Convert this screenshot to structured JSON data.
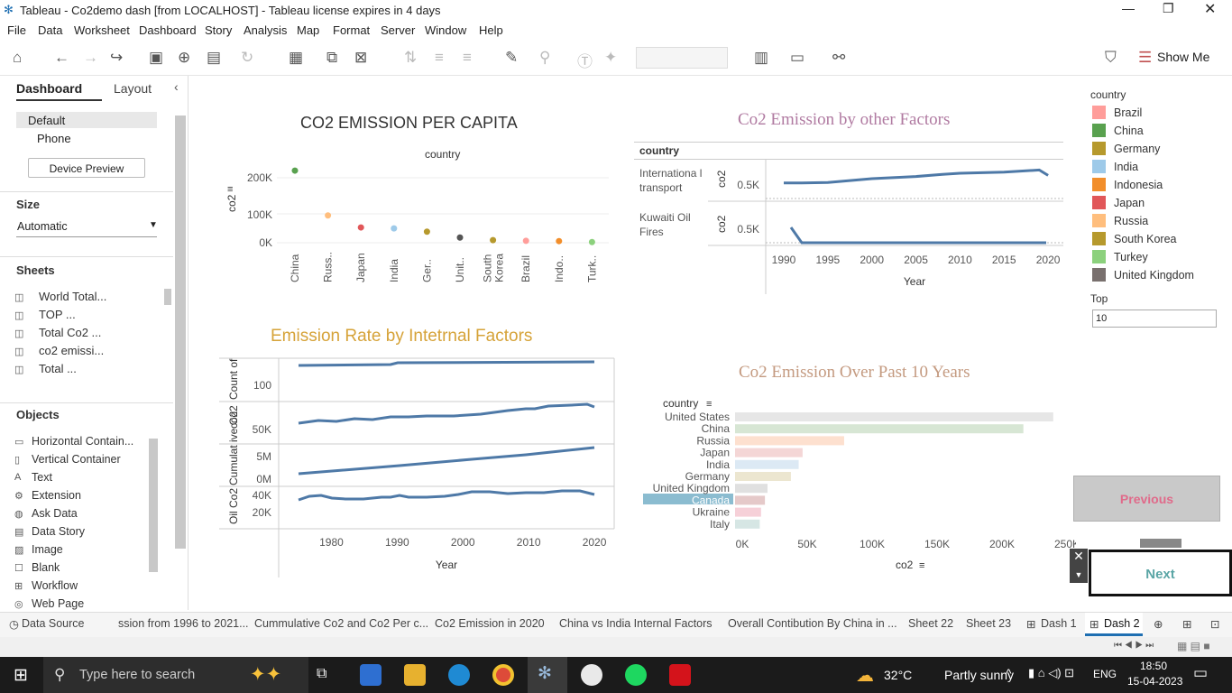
{
  "window": {
    "title": "Tableau - Co2demo dash [from LOCALHOST] - Tableau license expires in 4 days"
  },
  "menu": [
    "File",
    "Data",
    "Worksheet",
    "Dashboard",
    "Story",
    "Analysis",
    "Map",
    "Format",
    "Server",
    "Window",
    "Help"
  ],
  "toolbar": {
    "show_me": "Show Me"
  },
  "left": {
    "tab_dashboard": "Dashboard",
    "tab_layout": "Layout",
    "device_default": "Default",
    "device_phone": "Phone",
    "device_preview": "Device Preview",
    "size_label": "Size",
    "size_value": "Automatic",
    "sheets_label": "Sheets",
    "sheets": [
      "World Total...",
      "TOP ...",
      "Total Co2 ...",
      "co2 emissi...",
      "Total ..."
    ],
    "objects_label": "Objects",
    "objects": [
      "Horizontal Contain...",
      "Vertical Container",
      "Text",
      "Extension",
      "Ask Data",
      "Data Story",
      "Image",
      "Blank",
      "Workflow",
      "Web Page"
    ]
  },
  "chart1": {
    "title": "CO2 EMISSION PER CAPITA",
    "header": "country",
    "ylabel": "co2",
    "ticks": [
      "200K",
      "100K",
      "0K"
    ],
    "cats": [
      "China",
      "Russ..",
      "Japan",
      "India",
      "Ger..",
      "Unit..",
      "South Korea",
      "Brazil",
      "Indo..",
      "Turk.."
    ]
  },
  "chart2": {
    "title": "Co2 Emission by other Factors",
    "header": "country",
    "row1": "Internationa l transport",
    "row2": "Kuwaiti Oil Fires",
    "measure": "co2",
    "tick": "0.5K",
    "years": [
      "1990",
      "1995",
      "2000",
      "2005",
      "2010",
      "2015",
      "2020"
    ],
    "xlabel": "Year"
  },
  "chart3": {
    "title": "Emission Rate by Intetrnal Factors",
    "rows": [
      "Count of Co2e..",
      "co2",
      "Cumulat ive Co2",
      "Oil Co2"
    ],
    "ticks": [
      "100",
      "50K",
      "5M",
      "0M",
      "40K",
      "20K"
    ],
    "years": [
      "1980",
      "1990",
      "2000",
      "2010",
      "2020"
    ],
    "xlabel": "Year"
  },
  "chart4": {
    "title": "Co2 Emission Over Past 10 Years",
    "header": "country",
    "xlabel": "co2",
    "ticks": [
      "0K",
      "50K",
      "100K",
      "150K",
      "200K",
      "250K"
    ]
  },
  "legend": {
    "title": "country",
    "top_label": "Top",
    "top_value": "10"
  },
  "buttons": {
    "previous": "Previous",
    "next": "Next"
  },
  "tabs": [
    "Data Source",
    "ssion from 1996 to 2021...",
    "Cummulative Co2 and Co2 Per c...",
    "Co2 Emission in 2020",
    "China vs India Internal Factors",
    "Overall Contibution By China in ...",
    "Sheet 22",
    "Sheet 23",
    "Dash 1",
    "Dash 2"
  ],
  "taskbar": {
    "search": "Type here to search",
    "temp": "32°C",
    "weather": "Partly sunny",
    "lang": "ENG",
    "time": "18:50",
    "date": "15-04-2023"
  },
  "chart_data": [
    {
      "type": "scatter",
      "title": "CO2 EMISSION PER CAPITA",
      "ylabel": "co2",
      "ylim": [
        0,
        230000
      ],
      "categories": [
        "China",
        "Russia",
        "Japan",
        "India",
        "Germany",
        "United Kingdom",
        "South Korea",
        "Brazil",
        "Indonesia",
        "Turkey"
      ],
      "values": [
        222000,
        84000,
        47000,
        44000,
        34000,
        16000,
        8000,
        6000,
        5000,
        2000
      ],
      "colors": [
        "#59a14f",
        "#ffbe7d",
        "#e15759",
        "#9ecae9",
        "#b6992d",
        "#555555",
        "#b6992d",
        "#ff9d9a",
        "#f28e2b",
        "#8cd17d"
      ]
    },
    {
      "type": "line",
      "title": "Co2 Emission by other Factors",
      "xlabel": "Year",
      "x": [
        1990,
        1992,
        1995,
        2000,
        2005,
        2008,
        2010,
        2015,
        2019,
        2020
      ],
      "series": [
        {
          "name": "Internationa l transport",
          "values": [
            0.52,
            0.52,
            0.53,
            0.6,
            0.64,
            0.68,
            0.7,
            0.72,
            0.76,
            0.66
          ]
        }
      ]
    },
    {
      "type": "bar",
      "title": "Co2 Emission Over Past 10 Years",
      "xlabel": "co2",
      "categories": [
        "United States",
        "China",
        "Russia",
        "Japan",
        "India",
        "Germany",
        "United Kingdom",
        "Canada",
        "Ukraine",
        "Italy"
      ],
      "values": [
        245000,
        222000,
        84000,
        52000,
        49000,
        43000,
        25000,
        23000,
        20000,
        19000
      ],
      "colors": [
        "#e6e6e6",
        "#d7e6d4",
        "#fde0cf",
        "#f4d6d6",
        "#dce9f4",
        "#ece6d0",
        "#e0e0e0",
        "#e5c9c9",
        "#f6d0d8",
        "#d6e6e4"
      ]
    }
  ]
}
